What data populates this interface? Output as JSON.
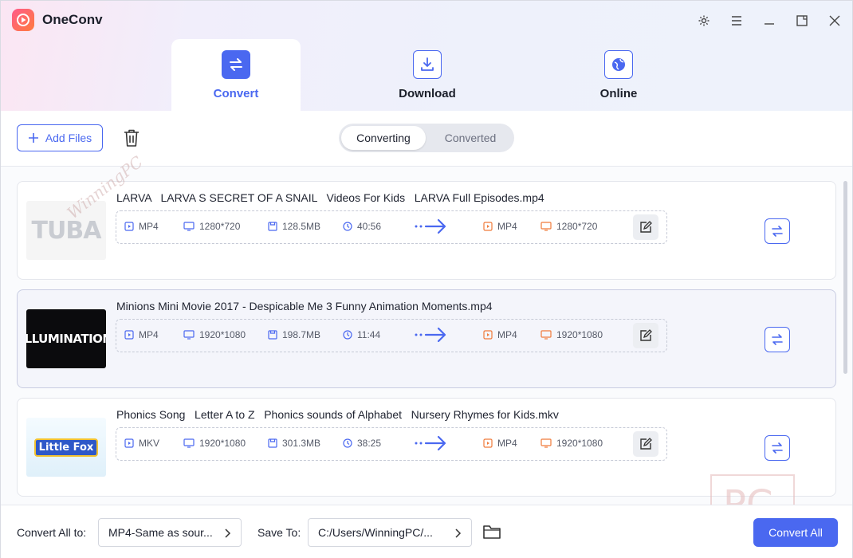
{
  "app": {
    "title": "OneConv"
  },
  "window_controls": [
    "settings-icon",
    "menu-icon",
    "minimize-icon",
    "maximize-icon",
    "close-icon"
  ],
  "tabs": [
    {
      "label": "Convert",
      "icon": "convert-icon",
      "active": true
    },
    {
      "label": "Download",
      "icon": "download-icon",
      "active": false
    },
    {
      "label": "Online",
      "icon": "globe-icon",
      "active": false
    }
  ],
  "toolbar": {
    "add_files_label": "Add Files",
    "segment": {
      "converting": "Converting",
      "converted": "Converted",
      "selected": "Converting"
    }
  },
  "files": [
    {
      "name": "LARVA   LARVA S SECRET OF A SNAIL   Videos For Kids   LARVA Full Episodes.mp4",
      "thumbnail_text": "TUBA",
      "source": {
        "format": "MP4",
        "resolution": "1280*720",
        "size": "128.5MB",
        "duration": "40:56"
      },
      "target": {
        "format": "MP4",
        "resolution": "1280*720"
      },
      "selected": false
    },
    {
      "name": "Minions Mini Movie 2017 - Despicable Me 3 Funny Animation Moments.mp4",
      "thumbnail_text": "ILLUMINATION",
      "source": {
        "format": "MP4",
        "resolution": "1920*1080",
        "size": "198.7MB",
        "duration": "11:44"
      },
      "target": {
        "format": "MP4",
        "resolution": "1920*1080"
      },
      "selected": true
    },
    {
      "name": "Phonics Song   Letter A to Z   Phonics sounds of Alphabet   Nursery Rhymes for Kids.mkv",
      "thumbnail_text": "Little Fox",
      "source": {
        "format": "MKV",
        "resolution": "1920*1080",
        "size": "301.3MB",
        "duration": "38:25"
      },
      "target": {
        "format": "MP4",
        "resolution": "1920*1080"
      },
      "selected": false
    }
  ],
  "footer": {
    "convert_all_to_label": "Convert All to:",
    "convert_all_to_value": "MP4-Same as sour...",
    "save_to_label": "Save To:",
    "save_to_value": "C:/Users/WinningPC/...",
    "convert_all_button": "Convert All"
  },
  "watermark": {
    "text": "WinningPC",
    "box_text": "PC"
  },
  "colors": {
    "accent": "#4a68f0",
    "target_icon": "#f07a3a"
  }
}
